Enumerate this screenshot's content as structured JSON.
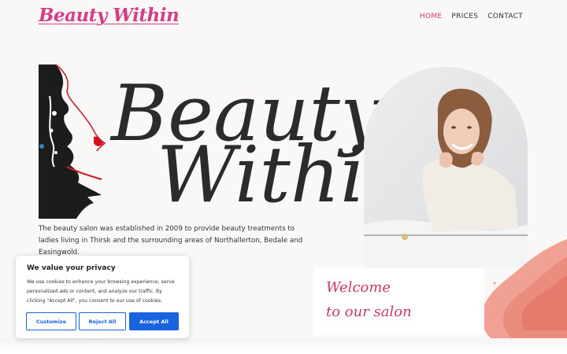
{
  "header": {
    "logo_text": "Beauty Within",
    "nav": [
      {
        "label": "HOME",
        "active": true
      },
      {
        "label": "PRICES",
        "active": false
      },
      {
        "label": "CONTACT",
        "active": false
      }
    ]
  },
  "hero": {
    "logo_word_1": "Beauty",
    "logo_word_2": "Within",
    "intro_text": "The beauty salon was established in 2009 to provide beauty treatments to ladies living in Thirsk and the surrounding areas of Northallerton, Bedale and Easingwold."
  },
  "welcome": {
    "line_1": "Welcome",
    "line_2": "to our salon"
  },
  "cookie_banner": {
    "title": "We value your privacy",
    "text": "We use cookies to enhance your browsing experience, serve personalized ads or content, and analyze our traffic. By clicking \"Accept All\", you consent to our use of cookies.",
    "customize_label": "Customize",
    "reject_label": "Reject All",
    "accept_label": "Accept All"
  },
  "colors": {
    "brand_pink": "#d23f86",
    "accent_blue": "#1a63e0"
  }
}
